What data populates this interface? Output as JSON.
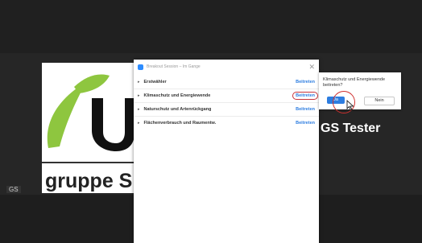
{
  "dialog": {
    "title": "Breakout Session – Im Gange",
    "rooms": [
      {
        "name": "Erstwähler",
        "join_label": "Beitreten"
      },
      {
        "name": "Klimaschutz und Energiewende",
        "join_label": "Beitreten"
      },
      {
        "name": "Naturschutz und Artenrückgang",
        "join_label": "Beitreten"
      },
      {
        "name": "Flächenverbrauch und Raumentw.",
        "join_label": "Beitreten"
      }
    ]
  },
  "confirm": {
    "message": "Klimaschutz und Energiewende beitreten?",
    "yes_label": "Ja",
    "no_label": "Nein"
  },
  "video": {
    "slide_footer": "gruppe S",
    "participant_name": "GS Tester",
    "corner_tag": "GS"
  },
  "colors": {
    "accent": "#2d7de0",
    "highlight_ring": "#d0302e",
    "logo_green": "#8ec63f"
  }
}
